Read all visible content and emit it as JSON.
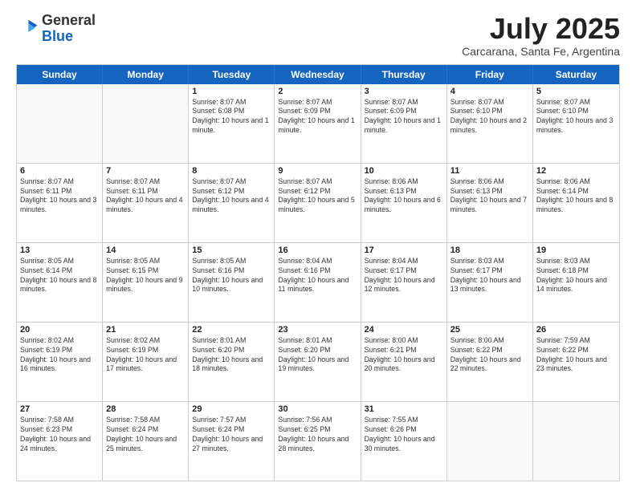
{
  "header": {
    "logo_general": "General",
    "logo_blue": "Blue",
    "month_title": "July 2025",
    "subtitle": "Carcarana, Santa Fe, Argentina"
  },
  "days_of_week": [
    "Sunday",
    "Monday",
    "Tuesday",
    "Wednesday",
    "Thursday",
    "Friday",
    "Saturday"
  ],
  "weeks": [
    [
      {
        "day": "",
        "info": ""
      },
      {
        "day": "",
        "info": ""
      },
      {
        "day": "1",
        "info": "Sunrise: 8:07 AM\nSunset: 6:08 PM\nDaylight: 10 hours and 1 minute."
      },
      {
        "day": "2",
        "info": "Sunrise: 8:07 AM\nSunset: 6:09 PM\nDaylight: 10 hours and 1 minute."
      },
      {
        "day": "3",
        "info": "Sunrise: 8:07 AM\nSunset: 6:09 PM\nDaylight: 10 hours and 1 minute."
      },
      {
        "day": "4",
        "info": "Sunrise: 8:07 AM\nSunset: 6:10 PM\nDaylight: 10 hours and 2 minutes."
      },
      {
        "day": "5",
        "info": "Sunrise: 8:07 AM\nSunset: 6:10 PM\nDaylight: 10 hours and 3 minutes."
      }
    ],
    [
      {
        "day": "6",
        "info": "Sunrise: 8:07 AM\nSunset: 6:11 PM\nDaylight: 10 hours and 3 minutes."
      },
      {
        "day": "7",
        "info": "Sunrise: 8:07 AM\nSunset: 6:11 PM\nDaylight: 10 hours and 4 minutes."
      },
      {
        "day": "8",
        "info": "Sunrise: 8:07 AM\nSunset: 6:12 PM\nDaylight: 10 hours and 4 minutes."
      },
      {
        "day": "9",
        "info": "Sunrise: 8:07 AM\nSunset: 6:12 PM\nDaylight: 10 hours and 5 minutes."
      },
      {
        "day": "10",
        "info": "Sunrise: 8:06 AM\nSunset: 6:13 PM\nDaylight: 10 hours and 6 minutes."
      },
      {
        "day": "11",
        "info": "Sunrise: 8:06 AM\nSunset: 6:13 PM\nDaylight: 10 hours and 7 minutes."
      },
      {
        "day": "12",
        "info": "Sunrise: 8:06 AM\nSunset: 6:14 PM\nDaylight: 10 hours and 8 minutes."
      }
    ],
    [
      {
        "day": "13",
        "info": "Sunrise: 8:05 AM\nSunset: 6:14 PM\nDaylight: 10 hours and 8 minutes."
      },
      {
        "day": "14",
        "info": "Sunrise: 8:05 AM\nSunset: 6:15 PM\nDaylight: 10 hours and 9 minutes."
      },
      {
        "day": "15",
        "info": "Sunrise: 8:05 AM\nSunset: 6:16 PM\nDaylight: 10 hours and 10 minutes."
      },
      {
        "day": "16",
        "info": "Sunrise: 8:04 AM\nSunset: 6:16 PM\nDaylight: 10 hours and 11 minutes."
      },
      {
        "day": "17",
        "info": "Sunrise: 8:04 AM\nSunset: 6:17 PM\nDaylight: 10 hours and 12 minutes."
      },
      {
        "day": "18",
        "info": "Sunrise: 8:03 AM\nSunset: 6:17 PM\nDaylight: 10 hours and 13 minutes."
      },
      {
        "day": "19",
        "info": "Sunrise: 8:03 AM\nSunset: 6:18 PM\nDaylight: 10 hours and 14 minutes."
      }
    ],
    [
      {
        "day": "20",
        "info": "Sunrise: 8:02 AM\nSunset: 6:19 PM\nDaylight: 10 hours and 16 minutes."
      },
      {
        "day": "21",
        "info": "Sunrise: 8:02 AM\nSunset: 6:19 PM\nDaylight: 10 hours and 17 minutes."
      },
      {
        "day": "22",
        "info": "Sunrise: 8:01 AM\nSunset: 6:20 PM\nDaylight: 10 hours and 18 minutes."
      },
      {
        "day": "23",
        "info": "Sunrise: 8:01 AM\nSunset: 6:20 PM\nDaylight: 10 hours and 19 minutes."
      },
      {
        "day": "24",
        "info": "Sunrise: 8:00 AM\nSunset: 6:21 PM\nDaylight: 10 hours and 20 minutes."
      },
      {
        "day": "25",
        "info": "Sunrise: 8:00 AM\nSunset: 6:22 PM\nDaylight: 10 hours and 22 minutes."
      },
      {
        "day": "26",
        "info": "Sunrise: 7:59 AM\nSunset: 6:22 PM\nDaylight: 10 hours and 23 minutes."
      }
    ],
    [
      {
        "day": "27",
        "info": "Sunrise: 7:58 AM\nSunset: 6:23 PM\nDaylight: 10 hours and 24 minutes."
      },
      {
        "day": "28",
        "info": "Sunrise: 7:58 AM\nSunset: 6:24 PM\nDaylight: 10 hours and 25 minutes."
      },
      {
        "day": "29",
        "info": "Sunrise: 7:57 AM\nSunset: 6:24 PM\nDaylight: 10 hours and 27 minutes."
      },
      {
        "day": "30",
        "info": "Sunrise: 7:56 AM\nSunset: 6:25 PM\nDaylight: 10 hours and 28 minutes."
      },
      {
        "day": "31",
        "info": "Sunrise: 7:55 AM\nSunset: 6:26 PM\nDaylight: 10 hours and 30 minutes."
      },
      {
        "day": "",
        "info": ""
      },
      {
        "day": "",
        "info": ""
      }
    ]
  ]
}
